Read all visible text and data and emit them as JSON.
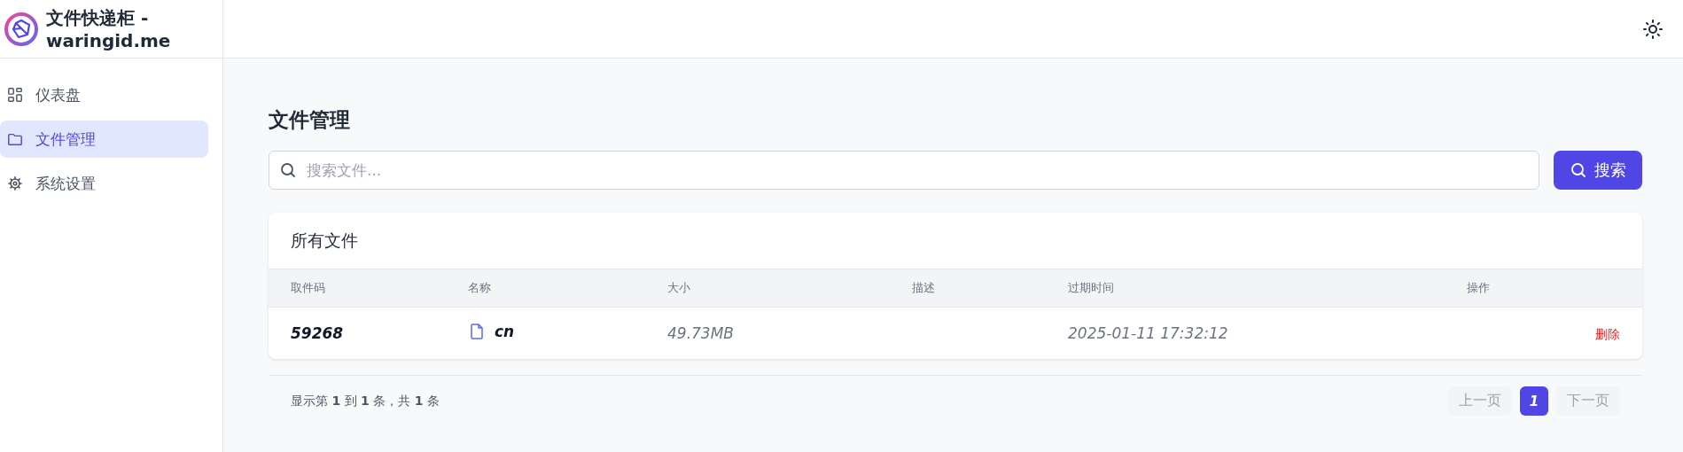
{
  "app": {
    "title": "文件快递柜 - waringid.me"
  },
  "sidebar": {
    "items": [
      {
        "label": "仪表盘",
        "kind": "grid",
        "selected": false
      },
      {
        "label": "文件管理",
        "kind": "folder",
        "selected": true
      },
      {
        "label": "系统设置",
        "kind": "gear",
        "selected": false
      }
    ]
  },
  "page": {
    "title": "文件管理"
  },
  "search": {
    "placeholder": "搜索文件...",
    "button": "搜索"
  },
  "card": {
    "title": "所有文件"
  },
  "table": {
    "columns": [
      "取件码",
      "名称",
      "大小",
      "描述",
      "过期时间",
      "操作"
    ],
    "rows": [
      {
        "code": "59268",
        "name": "cn",
        "size": "49.73MB",
        "expires": "2025-01-11 17:32:12",
        "action": "删除"
      }
    ]
  },
  "footer": {
    "summary": "显示第 **1** 到 **1** 条，共 **1** 条",
    "prev": "上一页",
    "pages": [
      {
        "label": "1",
        "selected": true
      }
    ],
    "next": "下一页"
  }
}
